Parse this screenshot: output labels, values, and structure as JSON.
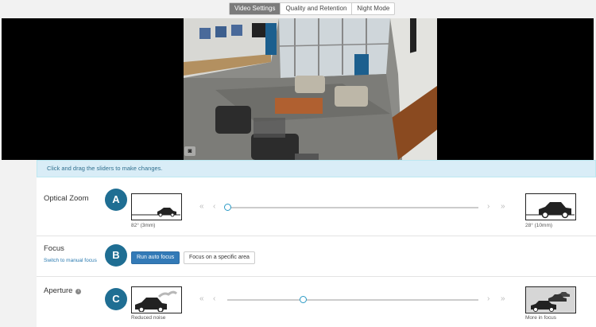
{
  "tabs": [
    {
      "label": "Video Settings",
      "active": true
    },
    {
      "label": "Quality and Retention",
      "active": false
    },
    {
      "label": "Night Mode",
      "active": false
    }
  ],
  "info_bar": {
    "text": "Click and drag the sliders to make changes."
  },
  "zoom": {
    "label": "Optical Zoom",
    "badge": "A",
    "left_caption": "82° (3mm)",
    "right_caption": "28° (10mm)",
    "slider_value": 0.0,
    "arrows": {
      "first": "«",
      "prev": "‹",
      "next": "›",
      "last": "»"
    }
  },
  "focus": {
    "label": "Focus",
    "link": "Switch to manual focus",
    "badge": "B",
    "auto_button": "Run auto focus",
    "area_button": "Focus on a specific area"
  },
  "aperture": {
    "label": "Aperture",
    "badge": "C",
    "info_icon": "i",
    "left_caption": "Reduced noise",
    "right_caption": "More in focus",
    "slider_value": 0.3,
    "arrows": {
      "first": "«",
      "prev": "‹",
      "next": "›",
      "last": "»"
    }
  },
  "colors": {
    "accent": "#1f6e93",
    "primary_button": "#337ab7",
    "slider_handle": "#2a9ac6"
  }
}
